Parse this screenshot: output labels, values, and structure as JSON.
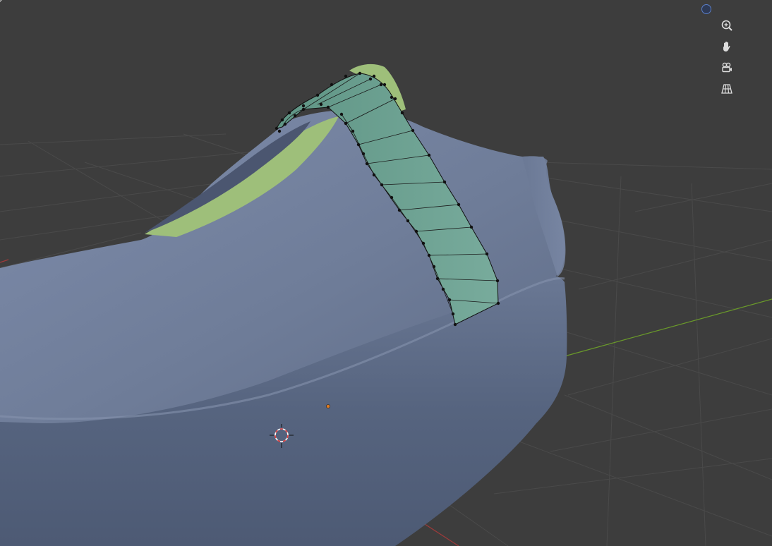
{
  "app": {
    "window_title": "",
    "mode": "edit",
    "view": "user-perspective"
  },
  "viewport": {
    "background": "#3d3d3d",
    "grid_color": "#4a4a4a",
    "x_axis_color": "#a03a3a",
    "y_axis_color": "#6a9a2a",
    "shoe_color": "#6f7d99",
    "sole_color": "#5c6a86",
    "inner_lining_color": "#9ebf7a",
    "strap_color": "#6fa394",
    "strap_selected_color": "#6fa394",
    "vertex_color": "#111111"
  },
  "nav_gizmo": {
    "axis_dot_color": "#5a7ec8",
    "buttons": [
      {
        "icon": "zoom-icon"
      },
      {
        "icon": "pan-hand-icon"
      },
      {
        "icon": "camera-view-icon"
      },
      {
        "icon": "perspective-grid-icon"
      }
    ]
  },
  "scene_markers": {
    "object_origin_color": "#e07b20",
    "cursor_3d_colors": [
      "#e04040",
      "#ffffff"
    ]
  }
}
